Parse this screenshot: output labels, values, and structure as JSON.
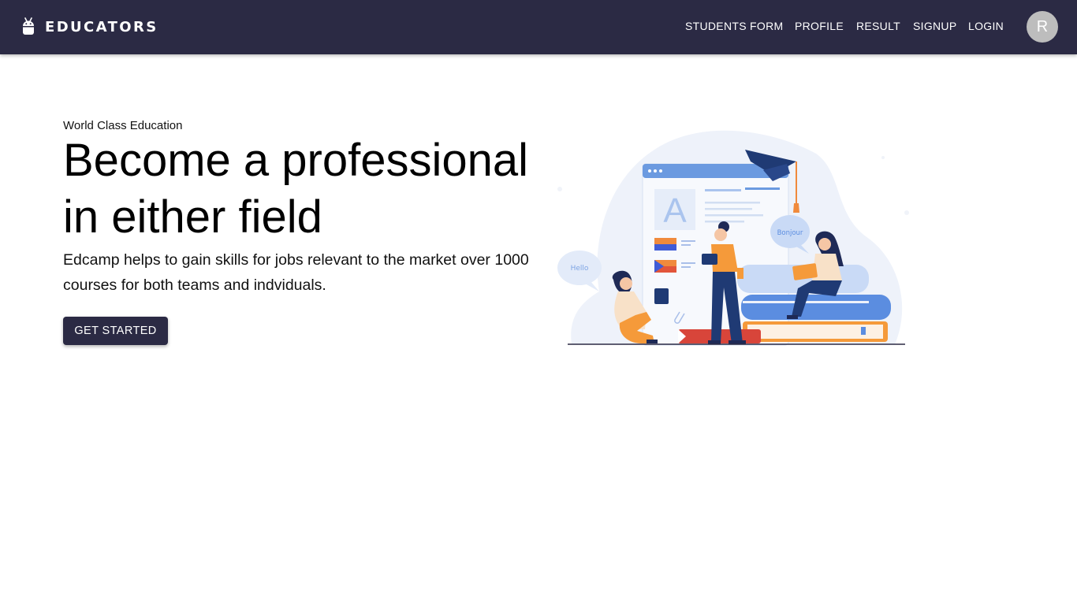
{
  "header": {
    "brand": "EDUCATORS",
    "brand_icon": "android-icon",
    "nav": [
      "STUDENTS FORM",
      "PROFILE",
      "RESULT",
      "SIGNUP",
      "LOGIN"
    ],
    "avatar_initial": "R"
  },
  "hero": {
    "eyebrow": "World Class Education",
    "headline": "Become a professional in either field",
    "description": "Edcamp helps to gain skills for jobs relevant to the market over 1000 courses for both teams and indviduals.",
    "cta_label": "GET STARTED",
    "illustration": {
      "speech_bubble_left": "Hello",
      "speech_bubble_right": "Bonjour",
      "board_letter": "A"
    }
  },
  "colors": {
    "navbar": "#2b2a44",
    "accent_blue": "#5b8de0",
    "accent_orange": "#f59a3a",
    "navy": "#1f3a74"
  }
}
